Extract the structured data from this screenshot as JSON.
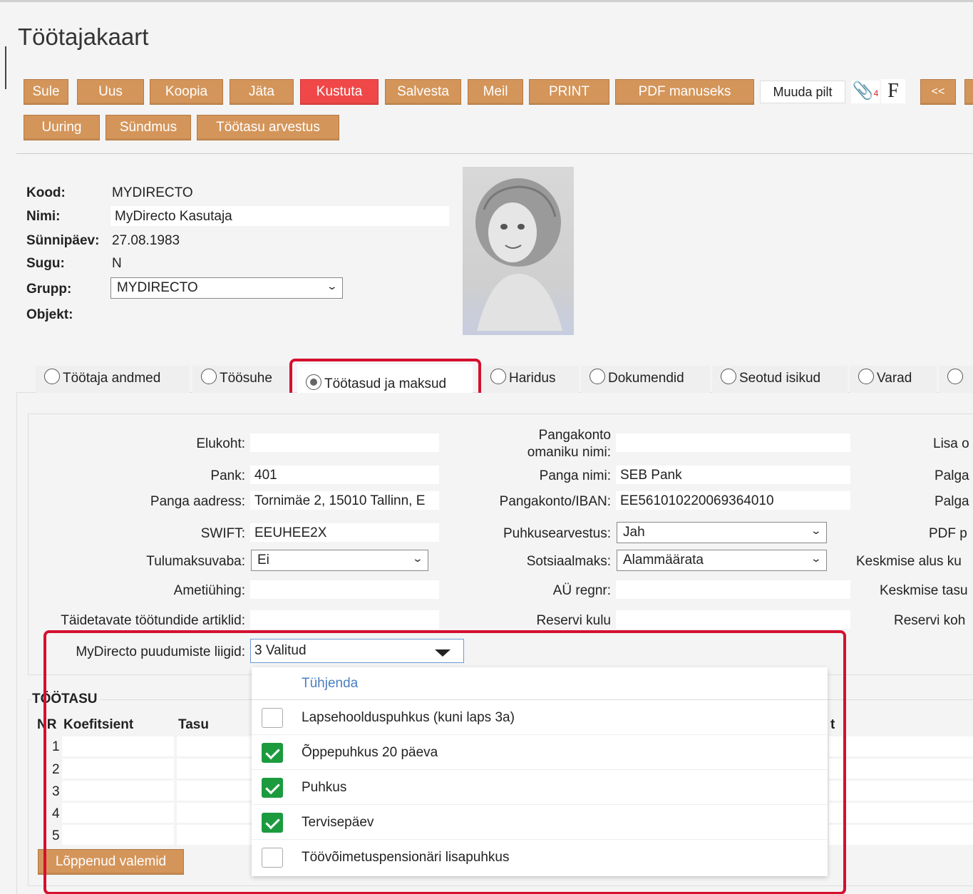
{
  "window": {
    "title": "Töötajakaart"
  },
  "toolbar": {
    "row1": [
      "Sule",
      "Uus",
      "Koopia",
      "Jäta",
      "Kustuta",
      "Salvesta",
      "Meil",
      "PRINT",
      "PDF manuseks"
    ],
    "change_picture": "Muuda pilt",
    "f_label": "F",
    "prev": "<<",
    "row2": [
      "Uuring",
      "Sündmus",
      "Töötasu arvestus"
    ]
  },
  "header": {
    "kood": {
      "label": "Kood:",
      "value": "MYDIRECTO"
    },
    "nimi": {
      "label": "Nimi:",
      "value": "MyDirecto Kasutaja"
    },
    "synnipaev": {
      "label": "Sünnipäev:",
      "value": "27.08.1983"
    },
    "sugu": {
      "label": "Sugu:",
      "value": "N"
    },
    "grupp": {
      "label": "Grupp:",
      "value": "MYDIRECTO"
    },
    "objekt": {
      "label": "Objekt:"
    }
  },
  "tabs": [
    "Töötaja andmed",
    "Töösuhe",
    "Töötasud ja maksud",
    "Haridus",
    "Dokumendid",
    "Seotud isikud",
    "Varad"
  ],
  "form": {
    "elukoht": {
      "label": "Elukoht:",
      "value": ""
    },
    "pank": {
      "label": "Pank:",
      "value": "401"
    },
    "panga_aadress": {
      "label": "Panga aadress:",
      "value": "Tornimäe 2, 15010 Tallinn, E"
    },
    "swift": {
      "label": "SWIFT:",
      "value": "EEUHEE2X"
    },
    "tulumaksuvaba": {
      "label": "Tulumaksuvaba:",
      "value": "Ei"
    },
    "ametiyhing": {
      "label": "Ametiühing:",
      "value": ""
    },
    "taidetavate": {
      "label": "Täidetavate töötundide artiklid:",
      "value": ""
    },
    "puudumiste": {
      "label": "MyDirecto puudumiste liigid:",
      "value": "3 Valitud"
    },
    "pangakonto_omanik": {
      "label_line1": "Pangakonto",
      "label_line2": "omaniku nimi:",
      "value": ""
    },
    "panga_nimi": {
      "label": "Panga nimi:",
      "value": "SEB Pank"
    },
    "iban": {
      "label": "Pangakonto/IBAN:",
      "value": "EE561010220069364010"
    },
    "puhkusearvestus": {
      "label": "Puhkusearvestus:",
      "value": "Jah"
    },
    "sotsiaalmaks": {
      "label": "Sotsiaalmaks:",
      "value": "Alammäärata"
    },
    "au_regnr": {
      "label": "AÜ regnr:",
      "value": ""
    },
    "reservi_kulu": {
      "label": "Reservi kulu",
      "value": ""
    },
    "right_col": [
      "Lisa o",
      "Palga",
      "Palga",
      "PDF p",
      "Keskmise alus ku",
      "Keskmise tasu",
      "Reservi koh"
    ]
  },
  "salary": {
    "title": "TÖÖTASU",
    "headers": [
      "NR",
      "Koefitsient",
      "Tasu"
    ],
    "extra_header": "t",
    "rows": [
      "1",
      "2",
      "3",
      "4",
      "5"
    ],
    "expired_button": "Lõppenud valemid"
  },
  "dropdown": {
    "clear": "Tühjenda",
    "options": [
      {
        "label": "Lapsehoolduspuhkus (kuni laps 3a)",
        "checked": false
      },
      {
        "label": "Õppepuhkus 20 päeva",
        "checked": true
      },
      {
        "label": "Puhkus",
        "checked": true
      },
      {
        "label": "Tervisepäev",
        "checked": true
      },
      {
        "label": "Töövõimetuspensionäri lisapuhkus",
        "checked": false
      }
    ]
  },
  "colors": {
    "button": "#d4955a",
    "danger": "#f04848",
    "highlight": "#d5102f",
    "check": "#1c9b3e",
    "link": "#4a7fc1"
  }
}
